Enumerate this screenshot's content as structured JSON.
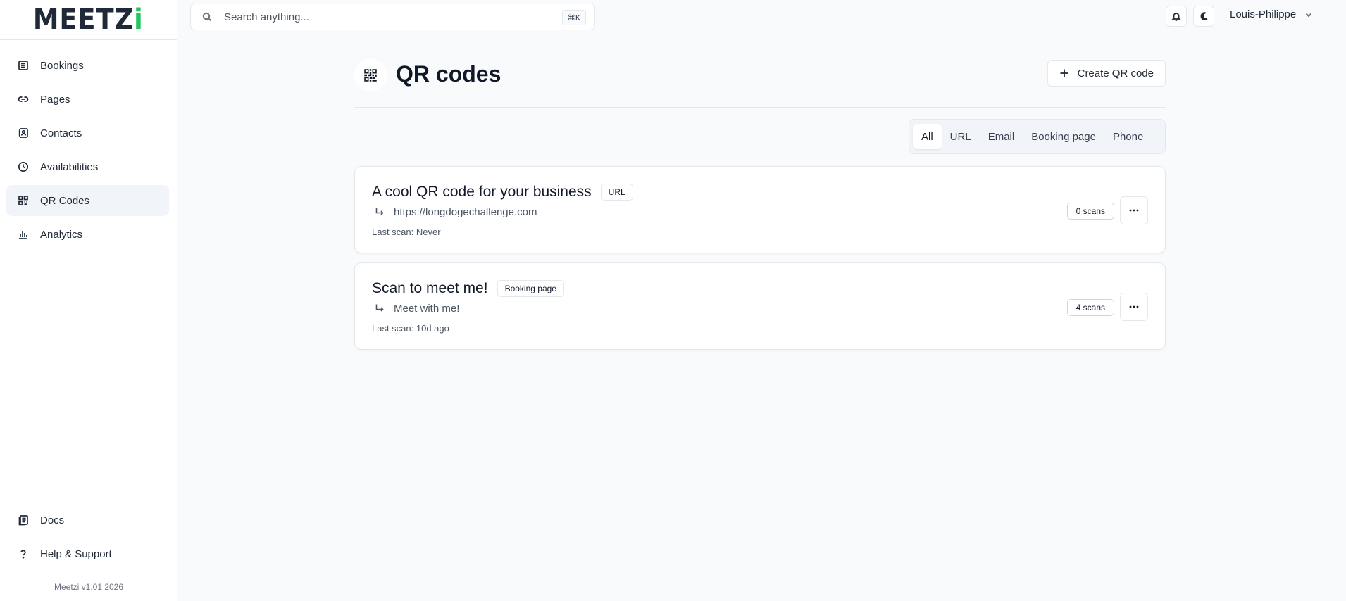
{
  "brand": {
    "logo_main": "MEETZ",
    "logo_accent": "i",
    "version": "Meetzi v1.01 2026",
    "accent_color": "#22c55e"
  },
  "search": {
    "placeholder": "Search anything...",
    "shortcut": "⌘K"
  },
  "header": {
    "user_name": "Louis-Philippe",
    "icons": [
      "bell-icon",
      "moon-icon",
      "chevron-down-icon"
    ]
  },
  "sidebar": {
    "items": [
      {
        "label": "Bookings",
        "icon": "bookings-icon"
      },
      {
        "label": "Pages",
        "icon": "link-icon"
      },
      {
        "label": "Contacts",
        "icon": "contacts-icon"
      },
      {
        "label": "Availabilities",
        "icon": "clock-icon"
      },
      {
        "label": "QR Codes",
        "icon": "qr-code-icon",
        "active": true
      },
      {
        "label": "Analytics",
        "icon": "bar-chart-icon"
      }
    ],
    "bottom_items": [
      {
        "label": "Docs",
        "icon": "docs-icon"
      },
      {
        "label": "Help & Support",
        "icon": "question-icon"
      }
    ]
  },
  "page": {
    "title": "QR codes",
    "create_label": "Create QR code"
  },
  "filters": [
    {
      "label": "All",
      "active": true
    },
    {
      "label": "URL"
    },
    {
      "label": "Email"
    },
    {
      "label": "Booking page"
    },
    {
      "label": "Phone"
    }
  ],
  "qr_codes": [
    {
      "title": "A cool QR code for your business",
      "type": "URL",
      "target": "https://longdogechallenge.com",
      "last_scan": "Last scan: Never",
      "scans": "0 scans"
    },
    {
      "title": "Scan to meet me!",
      "type": "Booking page",
      "target": "Meet with me!",
      "last_scan": "Last scan: 10d ago",
      "scans": "4 scans"
    }
  ]
}
